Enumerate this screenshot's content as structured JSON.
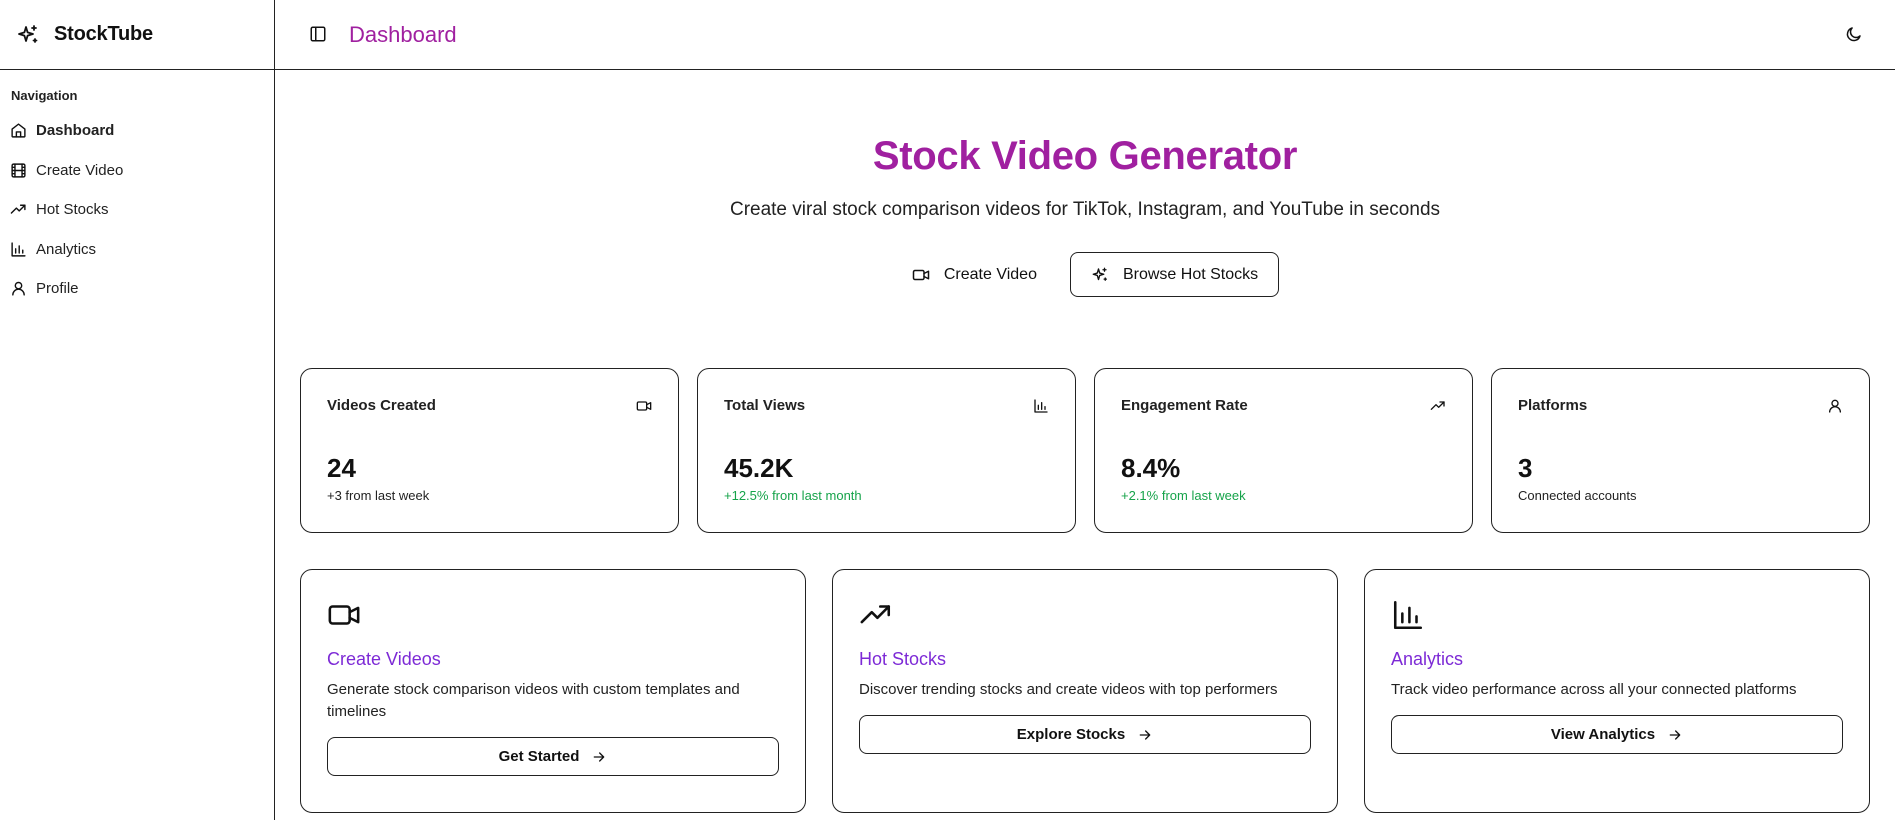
{
  "brand": {
    "name": "StockTube",
    "icon": "sparkles-icon"
  },
  "sidebar": {
    "heading": "Navigation",
    "items": [
      {
        "label": "Dashboard",
        "icon": "home-icon",
        "active": true
      },
      {
        "label": "Create Video",
        "icon": "film-icon"
      },
      {
        "label": "Hot Stocks",
        "icon": "trending-up-icon"
      },
      {
        "label": "Analytics",
        "icon": "bar-chart-icon"
      },
      {
        "label": "Profile",
        "icon": "user-icon"
      }
    ]
  },
  "header": {
    "title": "Dashboard"
  },
  "hero": {
    "title": "Stock Video Generator",
    "subtitle": "Create viral stock comparison videos for TikTok, Instagram, and YouTube in seconds",
    "primary_label": "Create Video",
    "secondary_label": "Browse Hot Stocks"
  },
  "stats": [
    {
      "title": "Videos Created",
      "value": "24",
      "sub": "+3 from last week",
      "icon": "video-icon"
    },
    {
      "title": "Total Views",
      "value": "45.2K",
      "sub": "+12.5% from last month",
      "icon": "bar-chart-icon"
    },
    {
      "title": "Engagement Rate",
      "value": "8.4%",
      "sub": "+2.1% from last week",
      "icon": "trending-up-icon"
    },
    {
      "title": "Platforms",
      "value": "3",
      "sub": "Connected accounts",
      "icon": "user-icon"
    }
  ],
  "features": [
    {
      "title": "Create Videos",
      "desc": "Generate stock comparison videos with custom templates and timelines",
      "button": "Get Started",
      "icon": "video-icon"
    },
    {
      "title": "Hot Stocks",
      "desc": "Discover trending stocks and create videos with top performers",
      "button": "Explore Stocks",
      "icon": "trending-up-icon"
    },
    {
      "title": "Analytics",
      "desc": "Track video performance across all your connected platforms",
      "button": "View Analytics",
      "icon": "bar-chart-icon"
    }
  ],
  "colors": {
    "accent": "#a020a0",
    "feature_title": "#7d2ad6",
    "positive": "#16a34a"
  }
}
